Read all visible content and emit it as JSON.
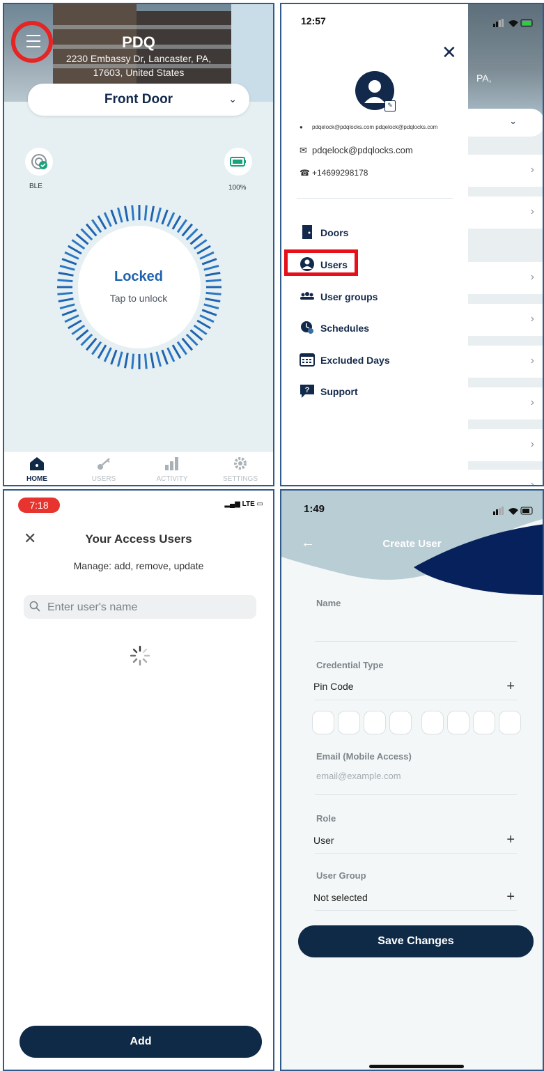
{
  "panel_home": {
    "title": "PDQ",
    "address_line1": "2230 Embassy Dr, Lancaster, PA,",
    "address_line2": "17603, United States",
    "door_selector": "Front Door",
    "ble_label": "BLE",
    "battery_label": "100%",
    "lock_status": "Locked",
    "lock_hint": "Tap to unlock",
    "tabs": [
      {
        "label": "HOME",
        "icon": "home-icon"
      },
      {
        "label": "USERS",
        "icon": "key-icon"
      },
      {
        "label": "ACTIVITY",
        "icon": "bar-chart-icon"
      },
      {
        "label": "SETTINGS",
        "icon": "gear-icon"
      }
    ],
    "highlight_color": "#e52424"
  },
  "panel_menu": {
    "time": "12:57",
    "background_text": "PA,",
    "profile": {
      "username": "pdqelock@pdqlocks.com pdqelock@pdqlocks.com",
      "email": "pdqelock@pdqlocks.com",
      "phone": "+14699298178"
    },
    "nav": [
      {
        "label": "Doors",
        "icon": "door-icon"
      },
      {
        "label": "Users",
        "icon": "user-circle-icon"
      },
      {
        "label": "User groups",
        "icon": "group-icon"
      },
      {
        "label": "Schedules",
        "icon": "clock-icon"
      },
      {
        "label": "Excluded Days",
        "icon": "calendar-icon"
      },
      {
        "label": "Support",
        "icon": "help-icon"
      }
    ],
    "highlighted_item": "Users",
    "highlight_color": "#e5101a"
  },
  "panel_users": {
    "time": "7:18",
    "network": "LTE",
    "title": "Your Access Users",
    "subtitle": "Manage: add, remove, update",
    "search_placeholder": "Enter user's name",
    "add_button": "Add"
  },
  "panel_create": {
    "time": "1:49",
    "title": "Create User",
    "name_label": "Name",
    "credential_label": "Credential Type",
    "credential_value": "Pin Code",
    "email_label": "Email (Mobile Access)",
    "email_placeholder": "email@example.com",
    "role_label": "Role",
    "role_value": "User",
    "group_label": "User Group",
    "group_value": "Not selected",
    "save_button": "Save Changes"
  },
  "colors": {
    "navy": "#0f2a46",
    "accent_blue": "#1f62ae",
    "frame_blue": "#2f5a8c"
  }
}
